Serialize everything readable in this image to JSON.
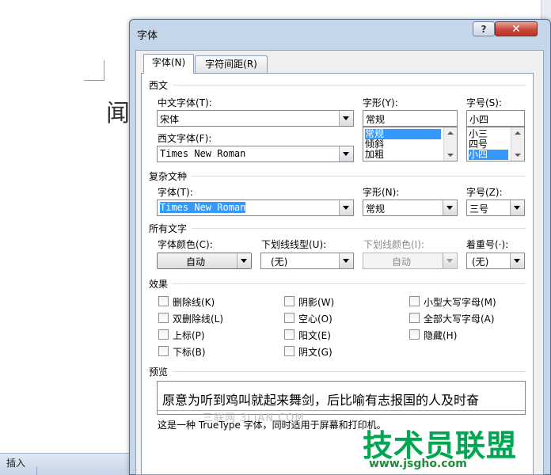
{
  "background_doc": {
    "char": "闻",
    "taskbar_label": "插入"
  },
  "dialog": {
    "title": "字体",
    "help_label": "?",
    "close_label": "✕",
    "tabs": [
      {
        "label": "字体(N)",
        "active": true
      },
      {
        "label": "字符间距(R)",
        "active": false
      }
    ],
    "western": {
      "section_title": "西文",
      "cn_font_label": "中文字体(T):",
      "cn_font_value": "宋体",
      "west_font_label": "西文字体(F):",
      "west_font_value": "Times New Roman",
      "style_label": "字形(Y):",
      "style_value": "常规",
      "style_list": [
        "常规",
        "倾斜",
        "加粗"
      ],
      "style_selected": "常规",
      "size_label": "字号(S):",
      "size_value": "小四",
      "size_list": [
        "小三",
        "四号",
        "小四"
      ],
      "size_selected": "小四"
    },
    "complex": {
      "section_title": "复杂文种",
      "font_label": "字体(T):",
      "font_value": "Times New Roman",
      "style_label": "字形(N):",
      "style_value": "常规",
      "size_label": "字号(Z):",
      "size_value": "三号"
    },
    "all_text": {
      "section_title": "所有文字",
      "color_label": "字体颜色(C):",
      "color_value": "自动",
      "underline_label": "下划线线型(U):",
      "underline_value": "(无)",
      "underline_color_label": "下划线颜色(I):",
      "underline_color_value": "自动",
      "emphasis_label": "着重号(·):",
      "emphasis_value": "(无)"
    },
    "effects": {
      "section_title": "效果",
      "col1": [
        "删除线(K)",
        "双删除线(L)",
        "上标(P)",
        "下标(B)"
      ],
      "col2": [
        "阴影(W)",
        "空心(O)",
        "阳文(E)",
        "阴文(G)"
      ],
      "col3": [
        "小型大写字母(M)",
        "全部大写字母(A)",
        "隐藏(H)"
      ]
    },
    "preview": {
      "section_title": "预览",
      "text": "原意为听到鸡叫就起来舞剑，后比喻有志报国的人及时奋",
      "note": "这是一种 TrueType 字体，同时适用于屏幕和打印机。"
    }
  },
  "watermark": {
    "site_cn": "技术员联盟",
    "site_url": "www.jsgho.com",
    "faint": "三联网 3LIAN.COM"
  },
  "colors": {
    "selection": "#3399ff",
    "title_bar": "#c6d6ea",
    "close_button": "#c8483a",
    "watermark": "#00a651"
  }
}
